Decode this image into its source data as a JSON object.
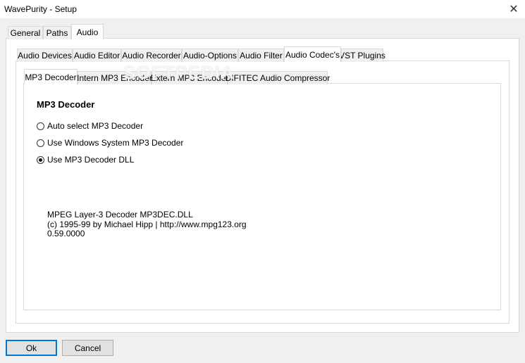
{
  "window": {
    "title": "WavePurity - Setup",
    "close_glyph": "✕"
  },
  "top_tabs": [
    "General",
    "Paths",
    "Audio"
  ],
  "audio_tabs": [
    "Audio Devices",
    "Audio Editor",
    "Audio Recorder",
    "Audio-Options",
    "Audio Filter",
    "Audio Codec's",
    "VST Plugins"
  ],
  "codec_tabs": [
    "MP3 Decoder",
    "Intern MP3 Encoder",
    "Extern MP3 Encoder",
    "DIFITEC Audio Compressor"
  ],
  "section": {
    "heading": "MP3 Decoder"
  },
  "options": [
    {
      "label": "Auto select MP3 Decoder",
      "checked": false
    },
    {
      "label": "Use Windows System MP3 Decoder",
      "checked": false
    },
    {
      "label": "Use MP3 Decoder DLL",
      "checked": true
    }
  ],
  "info": {
    "line1": "MPEG Layer-3 Decoder MP3DEC.DLL",
    "line2": "(c) 1995-99 by Michael Hipp | http://www.mpg123.org",
    "line3": "0.59.0000"
  },
  "buttons": {
    "ok": "Ok",
    "cancel": "Cancel"
  },
  "watermark": "SOFTPEDIA",
  "colors": {
    "accent": "#0078d7"
  }
}
